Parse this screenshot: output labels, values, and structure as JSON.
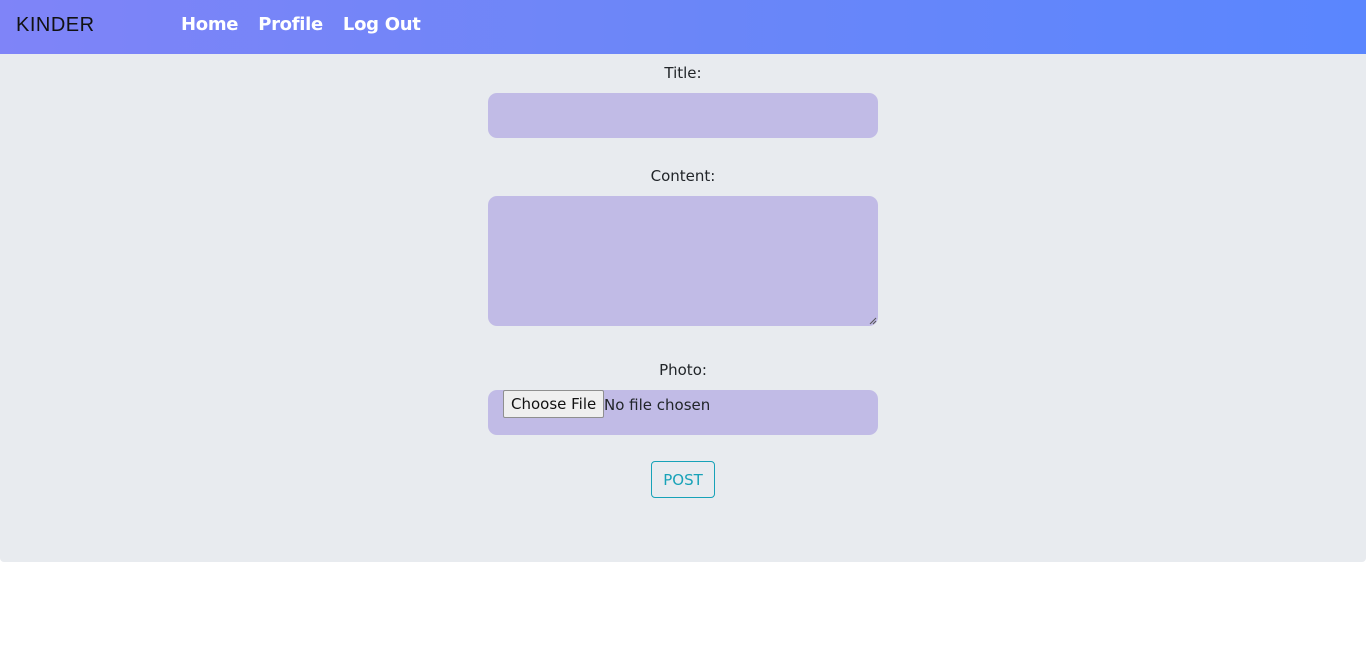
{
  "navbar": {
    "brand": "KINDER",
    "links": [
      {
        "label": "Home"
      },
      {
        "label": "Profile"
      },
      {
        "label": "Log Out"
      }
    ]
  },
  "form": {
    "title_label": "Title:",
    "title_value": "",
    "content_label": "Content:",
    "content_value": "",
    "photo_label": "Photo:",
    "file_button_label": "Choose File",
    "file_status": "No file chosen",
    "submit_label": "POST"
  },
  "colors": {
    "navbar_start": "#7f84f8",
    "navbar_end": "#5a86fe",
    "panel_background": "#e8ebef",
    "field_background": "#c1bbe6",
    "submit_accent": "#17a2b8"
  }
}
